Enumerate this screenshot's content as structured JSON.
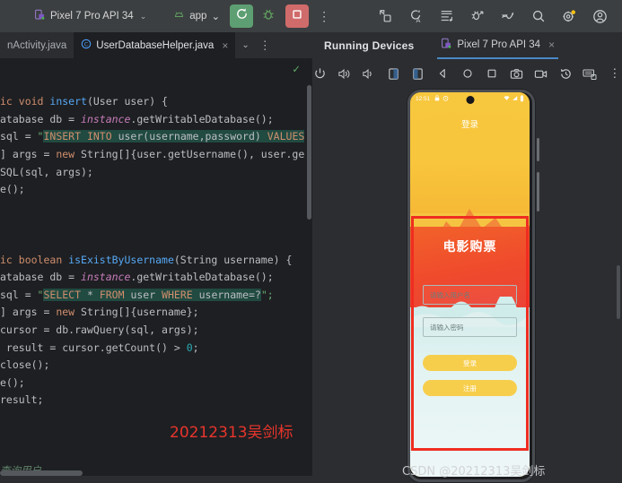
{
  "toolbar": {
    "device_selector": {
      "label": "Pixel 7 Pro API 34",
      "icon": "device-phone-icon",
      "caret": "⌄"
    },
    "app_selector": {
      "label": "app",
      "icon": "android-app-icon",
      "caret": "⌄"
    },
    "run_button": {
      "name": "run-button",
      "icon": "run-reload-icon",
      "color": "#5d9f72"
    },
    "debug_button": {
      "name": "debug-button",
      "icon": "bug-icon",
      "color": "#5d9f72"
    },
    "stop_button": {
      "name": "stop-button",
      "icon": "stop-square-icon",
      "color": "#d06b6b"
    },
    "overflow": "⋮",
    "right_icons": [
      {
        "name": "build-icon",
        "title": "Build"
      },
      {
        "name": "code-with-me-icon",
        "title": "Code With Me"
      },
      {
        "name": "format-code-icon",
        "title": "Reformat"
      },
      {
        "name": "debugger-icon",
        "title": "Debug"
      },
      {
        "name": "profiler-icon",
        "title": "Profiler"
      },
      {
        "name": "search-icon",
        "title": "Search Everywhere"
      },
      {
        "name": "settings-gear-icon",
        "title": "Settings",
        "badge": true,
        "badge_color": "#f5c116"
      },
      {
        "name": "account-avatar-icon",
        "title": "Account"
      }
    ]
  },
  "editor": {
    "tabs": [
      {
        "label": "nActivity.java",
        "active": false,
        "icon": "",
        "closable": false
      },
      {
        "label": "UserDatabaseHelper.java",
        "active": true,
        "icon": "class-c-icon",
        "closable": true,
        "close": "×"
      }
    ],
    "tab_caret": "⌄",
    "tab_overflow": "⋮",
    "inspection_ok": "✓",
    "code_lines": [
      {
        "segments": [
          {
            "t": "ic ",
            "c": "tok-kw"
          },
          {
            "t": "void ",
            "c": "tok-kw"
          },
          {
            "t": "insert",
            "c": "tok-fn"
          },
          {
            "t": "(User user) ",
            "c": ""
          },
          {
            "t": "{",
            "c": ""
          }
        ]
      },
      {
        "segments": [
          {
            "t": "atabase db = ",
            "c": ""
          },
          {
            "t": "instance",
            "c": "tok-field"
          },
          {
            "t": ".getWritableDatabase();",
            "c": ""
          }
        ]
      },
      {
        "segments": [
          {
            "t": "sql = ",
            "c": ""
          },
          {
            "t": "\"",
            "c": "tok-str"
          },
          {
            "t": "INSERT INTO ",
            "c": "tok-sql"
          },
          {
            "t": "user(username,password) ",
            "c": "tok-sqlid"
          },
          {
            "t": "VALUES",
            "c": "tok-sql"
          }
        ]
      },
      {
        "segments": [
          {
            "t": "] args = ",
            "c": ""
          },
          {
            "t": "new ",
            "c": "tok-kw"
          },
          {
            "t": "String[]{user.getUsername(), user.ge",
            "c": ""
          }
        ]
      },
      {
        "segments": [
          {
            "t": "SQL(sql, args);",
            "c": ""
          }
        ]
      },
      {
        "segments": [
          {
            "t": "e();",
            "c": ""
          }
        ]
      },
      {
        "segments": [
          {
            "t": "",
            "c": ""
          }
        ]
      },
      {
        "segments": [
          {
            "t": "",
            "c": ""
          }
        ]
      },
      {
        "segments": [
          {
            "t": "",
            "c": ""
          }
        ]
      },
      {
        "segments": [
          {
            "t": "ic ",
            "c": "tok-kw"
          },
          {
            "t": "boolean ",
            "c": "tok-kw"
          },
          {
            "t": "isExistByUsername",
            "c": "tok-fn"
          },
          {
            "t": "(String username) {",
            "c": ""
          }
        ]
      },
      {
        "segments": [
          {
            "t": "atabase db = ",
            "c": ""
          },
          {
            "t": "instance",
            "c": "tok-field"
          },
          {
            "t": ".getWritableDatabase();",
            "c": ""
          }
        ]
      },
      {
        "segments": [
          {
            "t": "sql = ",
            "c": ""
          },
          {
            "t": "\"",
            "c": "tok-str"
          },
          {
            "t": "SELECT ",
            "c": "tok-sql"
          },
          {
            "t": "* ",
            "c": "tok-sqlid"
          },
          {
            "t": "FROM ",
            "c": "tok-sql"
          },
          {
            "t": "user ",
            "c": "tok-sqlid"
          },
          {
            "t": "WHERE ",
            "c": "tok-sql"
          },
          {
            "t": "username=?",
            "c": "tok-sqlid"
          },
          {
            "t": "\";",
            "c": "tok-str"
          }
        ]
      },
      {
        "segments": [
          {
            "t": "] args = ",
            "c": ""
          },
          {
            "t": "new ",
            "c": "tok-kw"
          },
          {
            "t": "String[]{username};",
            "c": ""
          }
        ]
      },
      {
        "segments": [
          {
            "t": "cursor = db.rawQuery(sql, args);",
            "c": ""
          }
        ]
      },
      {
        "segments": [
          {
            "t": " result = cursor.getCount() > ",
            "c": ""
          },
          {
            "t": "0",
            "c": "tok-num"
          },
          {
            "t": ";",
            "c": ""
          }
        ]
      },
      {
        "segments": [
          {
            "t": "close();",
            "c": ""
          }
        ]
      },
      {
        "segments": [
          {
            "t": "e();",
            "c": ""
          }
        ]
      },
      {
        "segments": [
          {
            "t": "result;",
            "c": ""
          }
        ]
      },
      {
        "segments": [
          {
            "t": "",
            "c": ""
          }
        ]
      },
      {
        "segments": [
          {
            "t": "",
            "c": ""
          }
        ]
      },
      {
        "segments": [
          {
            "t": "",
            "c": ""
          }
        ]
      },
      {
        "segments": [
          {
            "t": "查询用户",
            "c": "tok-cmt"
          }
        ]
      }
    ],
    "watermark": "20212313吴剑标",
    "watermark_color": "#e8352c"
  },
  "devices_panel": {
    "title": "Running Devices",
    "tab": {
      "label": "Pixel 7 Pro API 34",
      "icon": "device-phone-icon",
      "close": "×"
    },
    "emulator_controls": [
      {
        "name": "power-icon"
      },
      {
        "name": "volume-up-icon"
      },
      {
        "name": "volume-down-icon"
      },
      {
        "name": "rotate-left-icon"
      },
      {
        "name": "rotate-right-icon"
      },
      {
        "name": "back-nav-icon"
      },
      {
        "name": "home-nav-icon"
      },
      {
        "name": "overview-nav-icon"
      },
      {
        "name": "screenshot-camera-icon"
      },
      {
        "name": "screen-record-icon"
      },
      {
        "name": "device-history-icon"
      },
      {
        "name": "keyboard-icon"
      },
      {
        "name": "more-options-icon",
        "glyph": "⋮"
      }
    ]
  },
  "phone_screen": {
    "status_bar": {
      "time": "12:51",
      "left_icons": [
        "lock-icon",
        "alarm-icon"
      ],
      "right_icons": [
        "wifi-icon",
        "signal-icon",
        "battery-icon"
      ]
    },
    "screen_title": "登录",
    "app_title": "电影购票",
    "username_field": {
      "placeholder": "请输入用户名",
      "value": ""
    },
    "password_field": {
      "placeholder": "请输入密码",
      "value": ""
    },
    "login_button": "登录",
    "register_button": "注册",
    "selection_highlight_color": "#ef2d20",
    "button_color": "#f7ce4c"
  },
  "watermark_footer": "CSDN @20212313吴剑标"
}
